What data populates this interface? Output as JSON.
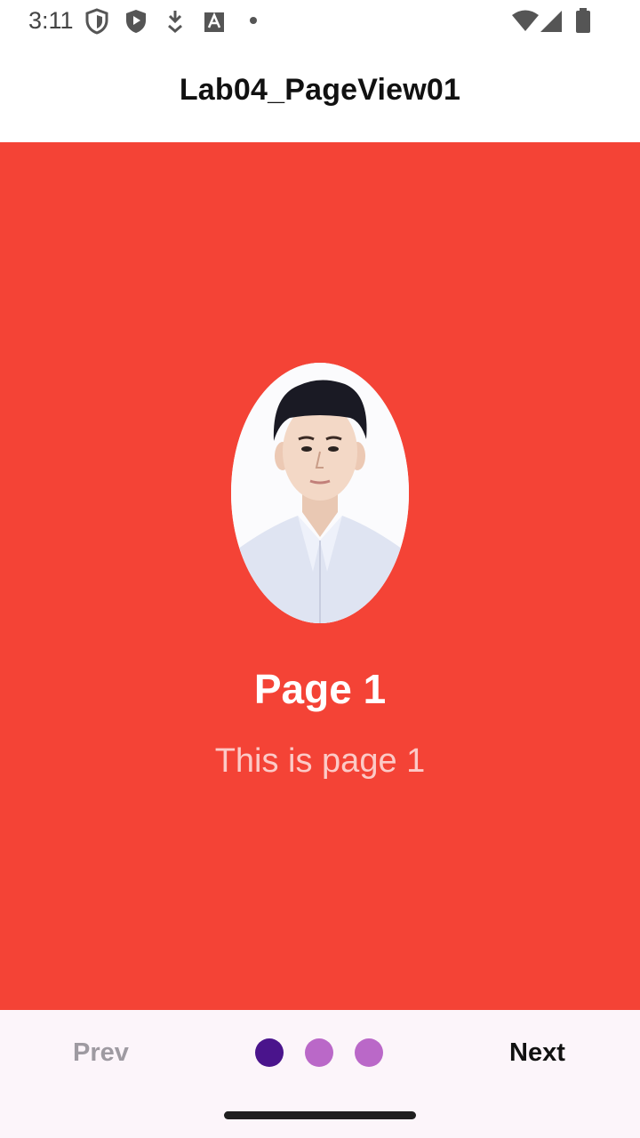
{
  "status_bar": {
    "time": "3:11",
    "left_icons": [
      "shield-outline-icon",
      "play-shield-icon",
      "download-arrow-icon",
      "font-a-icon",
      "dot-icon"
    ],
    "right_icons": [
      "wifi-icon",
      "cellular-signal-icon",
      "battery-icon"
    ]
  },
  "app_bar": {
    "title": "Lab04_PageView01"
  },
  "page": {
    "background_color": "#f44336",
    "title": "Page 1",
    "subtitle": "This is page 1",
    "avatar_icon": "person-photo"
  },
  "bottom_bar": {
    "prev_label": "Prev",
    "next_label": "Next",
    "page_count": 3,
    "active_index": 0,
    "dot_active_color": "#4a148c",
    "dot_inactive_color": "#ba68c8"
  }
}
